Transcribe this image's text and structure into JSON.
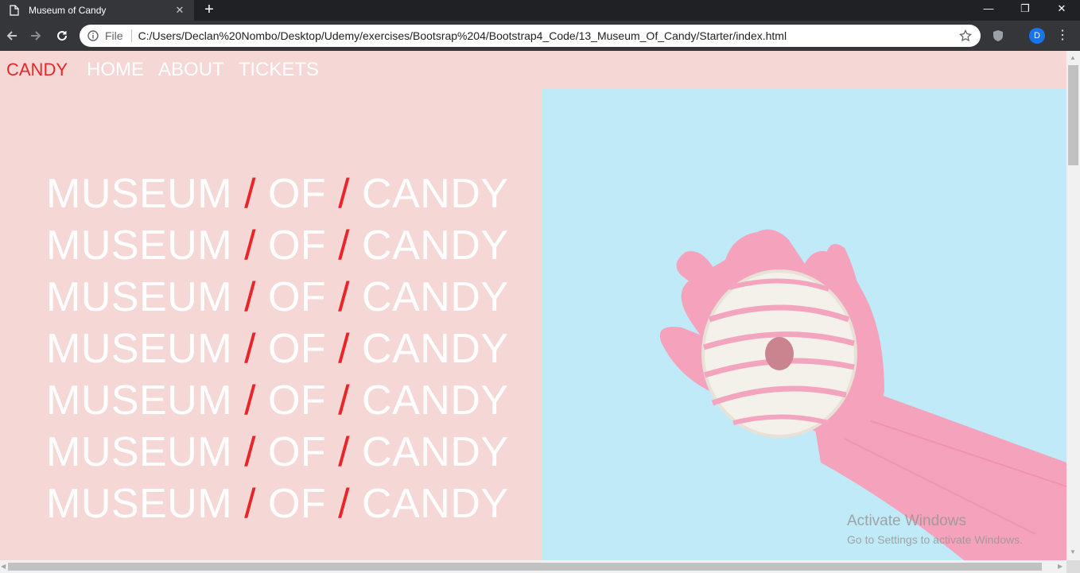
{
  "browser": {
    "tab_title": "Museum of Candy",
    "scheme_label": "File",
    "url": "C:/Users/Declan%20Nombo/Desktop/Udemy/exercises/Bootsrap%204/Bootstrap4_Code/13_Museum_Of_Candy/Starter/index.html",
    "profile_initial": "D"
  },
  "nav": {
    "brand": "CANDY",
    "links": [
      "HOME",
      "ABOUT",
      "TICKETS"
    ]
  },
  "hero": {
    "word1": "MUSEUM",
    "word2": "OF",
    "word3": "CANDY",
    "separator": "/"
  },
  "watermark": {
    "title": "Activate Windows",
    "subtitle": "Go to Settings to activate Windows."
  },
  "colors": {
    "page_bg": "#f5d8d6",
    "accent_red": "#e8262a",
    "image_bg": "#c0eaf8",
    "glove_pink": "#f5a2bd"
  },
  "icons": [
    "page-icon",
    "close-icon",
    "plus-icon",
    "minimize-icon",
    "restore-icon",
    "close-window-icon",
    "back-icon",
    "forward-icon",
    "reload-icon",
    "info-icon",
    "star-icon",
    "shield-icon",
    "menu-icon"
  ]
}
